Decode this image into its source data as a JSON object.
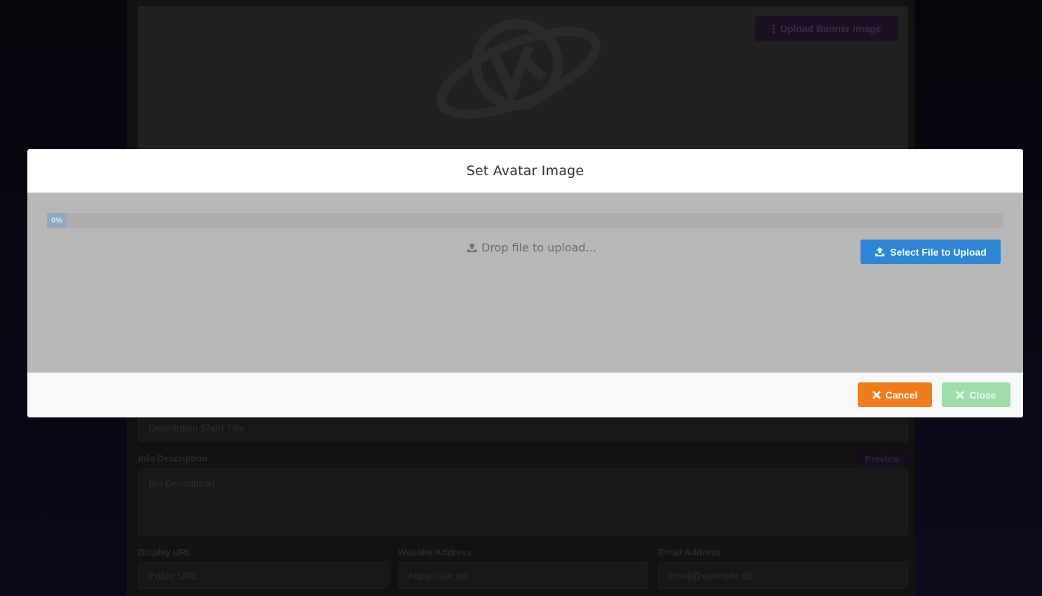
{
  "background": {
    "upload_banner_label": "Upload Banner Image",
    "description_short_title_placeholder": "Description Short Title",
    "info_description_label": "Info Description",
    "preview_label": "Preview",
    "bio_description_placeholder": "Bio Description",
    "display_url_label": "Display URL",
    "website_address_label": "Website Address",
    "email_address_label": "Email Address",
    "public_url_placeholder": "Public URL",
    "website_placeholder": "https://site.tld/",
    "email_placeholder": "email@example.tld"
  },
  "modal": {
    "title": "Set Avatar Image",
    "progress": {
      "percent": 0,
      "label": "0%"
    },
    "drop_text": "Drop file to upload...",
    "select_button_label": "Select File to Upload",
    "cancel_label": "Cancel",
    "close_label": "Close"
  },
  "icons": {
    "upload": "upload-icon",
    "close_x": "close-x-icon",
    "dots": "vertical-dots-icon"
  },
  "colors": {
    "primary": "#2c86d4",
    "cancel": "#f07d1c",
    "close_disabled": "#9edcaa",
    "progress": "#8fa9c2"
  }
}
